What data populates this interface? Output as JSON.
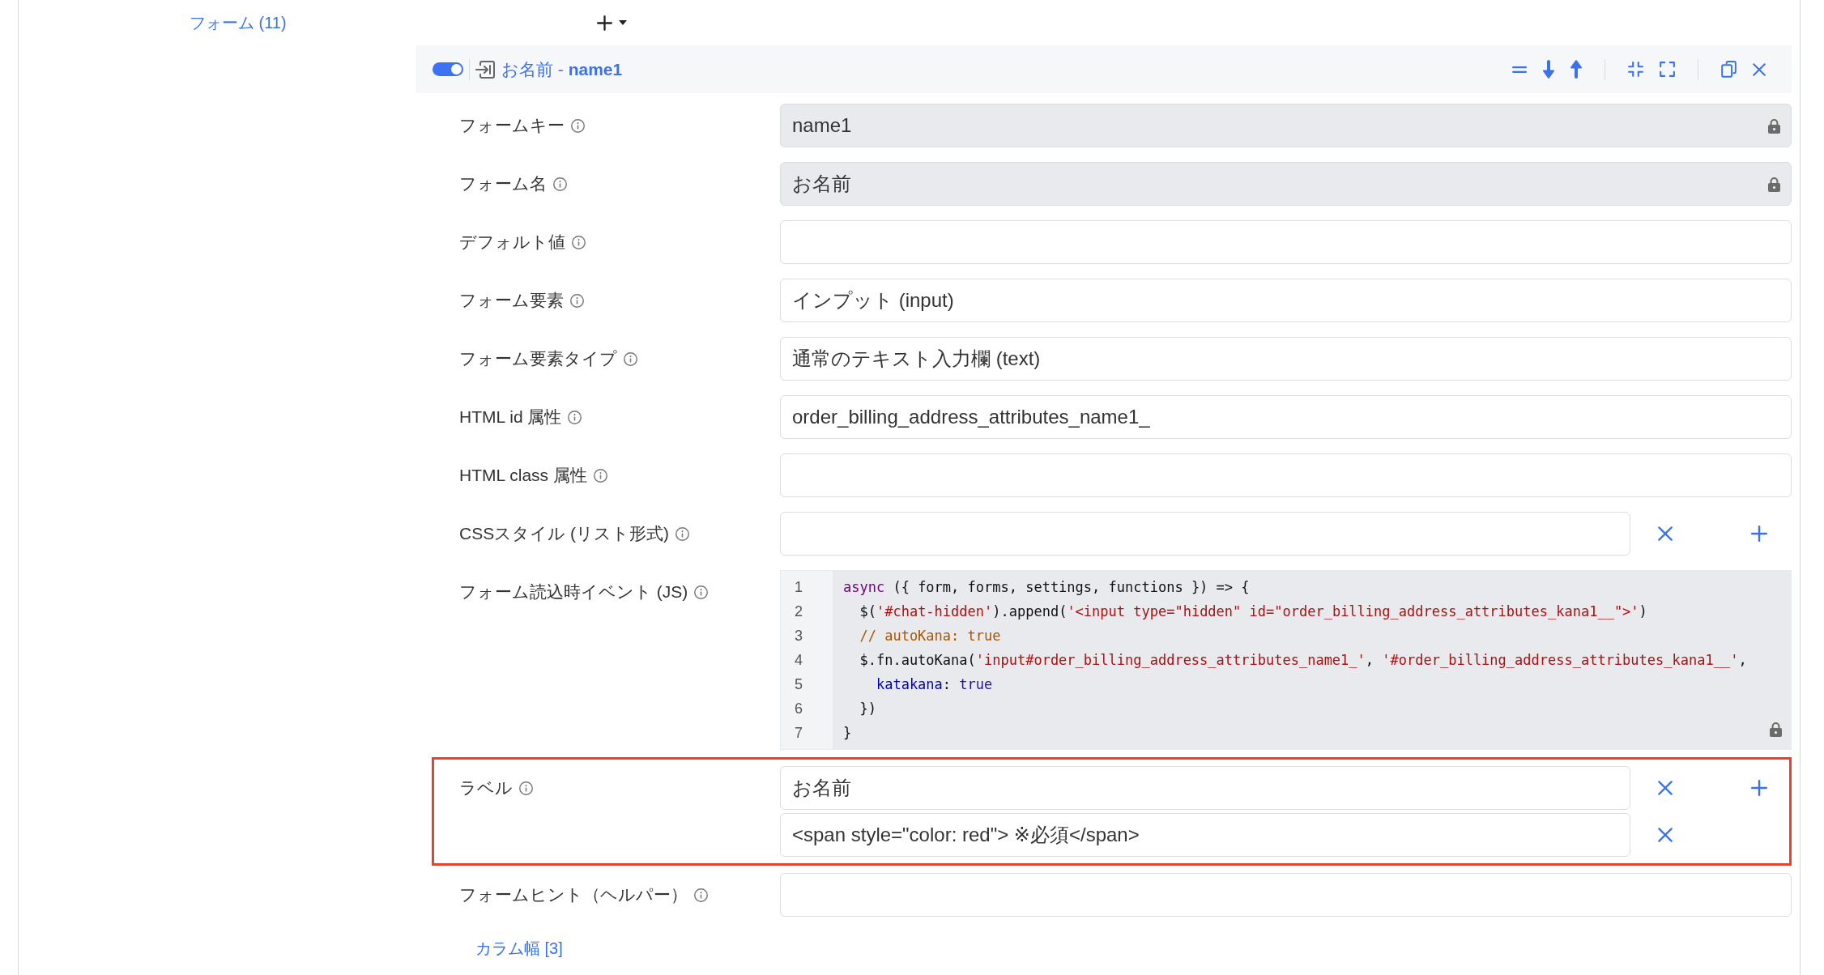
{
  "forms_link": "フォーム (11)",
  "form_card": {
    "enabled": true,
    "title": "お名前 - **name1**",
    "fields": [
      {
        "kind": "text",
        "label": "フォームキー",
        "value": "name1",
        "locked": true,
        "highlighted": false
      },
      {
        "kind": "text",
        "label": "フォーム名",
        "value": "お名前",
        "locked": true,
        "highlighted": false
      },
      {
        "kind": "text",
        "label": "デフォルト値",
        "locked": false,
        "highlighted": false
      },
      {
        "kind": "text",
        "label": "フォーム要素",
        "value": "インプット (input)",
        "locked": false,
        "highlighted": false
      },
      {
        "kind": "text",
        "label": "フォーム要素タイプ",
        "value": "通常のテキスト入力欄 (text)",
        "locked": false,
        "highlighted": false
      },
      {
        "kind": "text",
        "label": "HTML id 属性",
        "value": "order_billing_address_attributes_name1_",
        "locked": false,
        "highlighted": false
      },
      {
        "kind": "text",
        "label": "HTML class 属性",
        "locked": false,
        "highlighted": false
      },
      {
        "kind": "list",
        "label": "CSSスタイル (リスト形式)",
        "highlighted": false,
        "entries": [
          {
            "locked": false
          }
        ]
      },
      {
        "kind": "code",
        "label": "フォーム読込時イベント (JS)",
        "locked": true,
        "highlighted": false,
        "lines": [
          {
            "number": "1",
            "tokens": [
              {
                "kind": "keyword",
                "text": "async"
              },
              {
                "kind": "plain",
                "text": " ({ form, forms, settings, functions }) => {"
              }
            ]
          },
          {
            "number": "2",
            "tokens": [
              {
                "kind": "plain",
                "text": "  $("
              },
              {
                "kind": "string",
                "text": "'#chat-hidden'"
              },
              {
                "kind": "plain",
                "text": ").append("
              },
              {
                "kind": "string",
                "text": "'<input type=\"hidden\" id=\"order_billing_address_attributes_kana1__\">'"
              },
              {
                "kind": "plain",
                "text": ")"
              }
            ]
          },
          {
            "number": "3",
            "tokens": [
              {
                "kind": "comment",
                "text": "  // autoKana: true"
              }
            ]
          },
          {
            "number": "4",
            "tokens": [
              {
                "kind": "plain",
                "text": "  $.fn.autoKana("
              },
              {
                "kind": "string",
                "text": "'input#order_billing_address_attributes_name1_'"
              },
              {
                "kind": "plain",
                "text": ", "
              },
              {
                "kind": "string",
                "text": "'#order_billing_address_attributes_kana1__'"
              },
              {
                "kind": "plain",
                "text": ","
              }
            ]
          },
          {
            "number": "5",
            "tokens": [
              {
                "kind": "property",
                "text": "    katakana"
              },
              {
                "kind": "plain",
                "text": ": "
              },
              {
                "kind": "atom",
                "text": "true"
              }
            ]
          },
          {
            "number": "6",
            "tokens": [
              {
                "kind": "plain",
                "text": "  })"
              }
            ]
          },
          {
            "number": "7",
            "tokens": [
              {
                "kind": "plain",
                "text": "}"
              }
            ]
          }
        ]
      },
      {
        "kind": "list",
        "label": "ラベル",
        "highlighted": true,
        "entries": [
          {
            "value": "お名前",
            "locked": false
          },
          {
            "value": "<span style=\"color: red\"> ※必須</span>",
            "locked": false
          }
        ]
      },
      {
        "kind": "text",
        "label": "フォームヒント（ヘルパー）",
        "locked": false,
        "highlighted": false
      }
    ],
    "column_width_link": "カラム幅 [3]"
  }
}
